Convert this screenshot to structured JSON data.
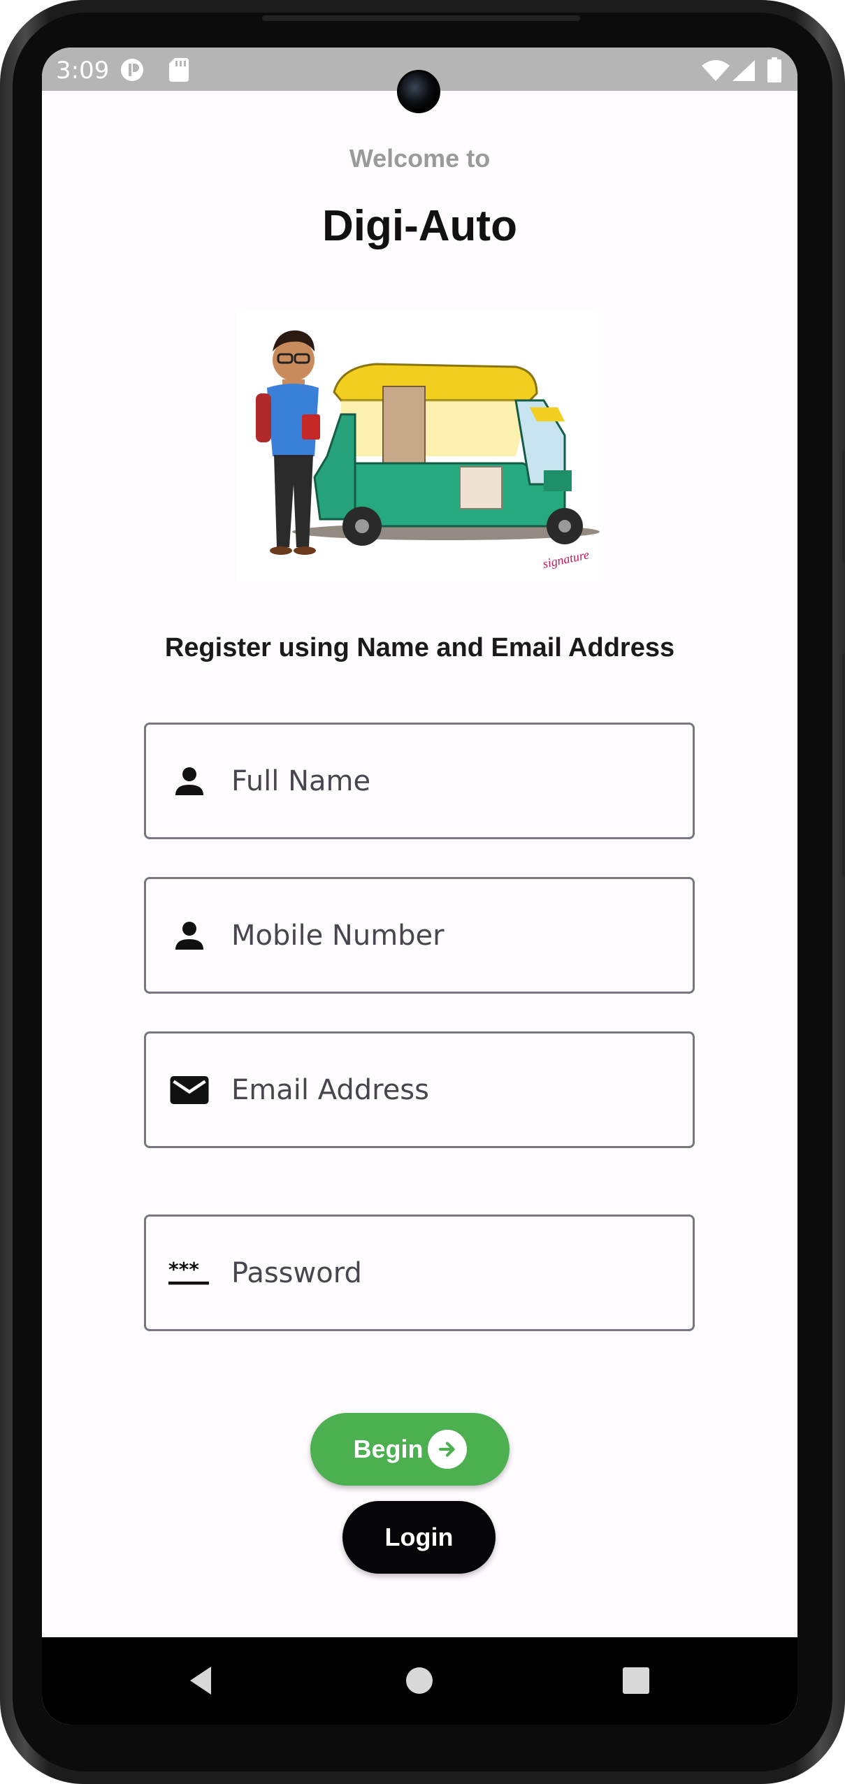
{
  "status_bar": {
    "time": "3:09"
  },
  "header": {
    "welcome": "Welcome to",
    "title": "Digi-Auto"
  },
  "illustration": {
    "description_icon": "boy-with-auto-rickshaw-illustration"
  },
  "form": {
    "subtitle": "Register using Name and Email Address",
    "full_name": {
      "placeholder": "Full Name",
      "value": "",
      "icon": "person-icon"
    },
    "mobile": {
      "placeholder": "Mobile Number",
      "value": "",
      "icon": "person-icon"
    },
    "email": {
      "placeholder": "Email Address",
      "value": "",
      "icon": "mail-icon"
    },
    "password": {
      "placeholder": "Password",
      "value": "",
      "icon": "password-icon"
    }
  },
  "actions": {
    "begin_label": "Begin",
    "login_label": "Login"
  },
  "colors": {
    "begin_button": "#4caf50",
    "login_button": "#050509",
    "background": "#fffbfe",
    "status_bar": "#b5b5b5"
  }
}
